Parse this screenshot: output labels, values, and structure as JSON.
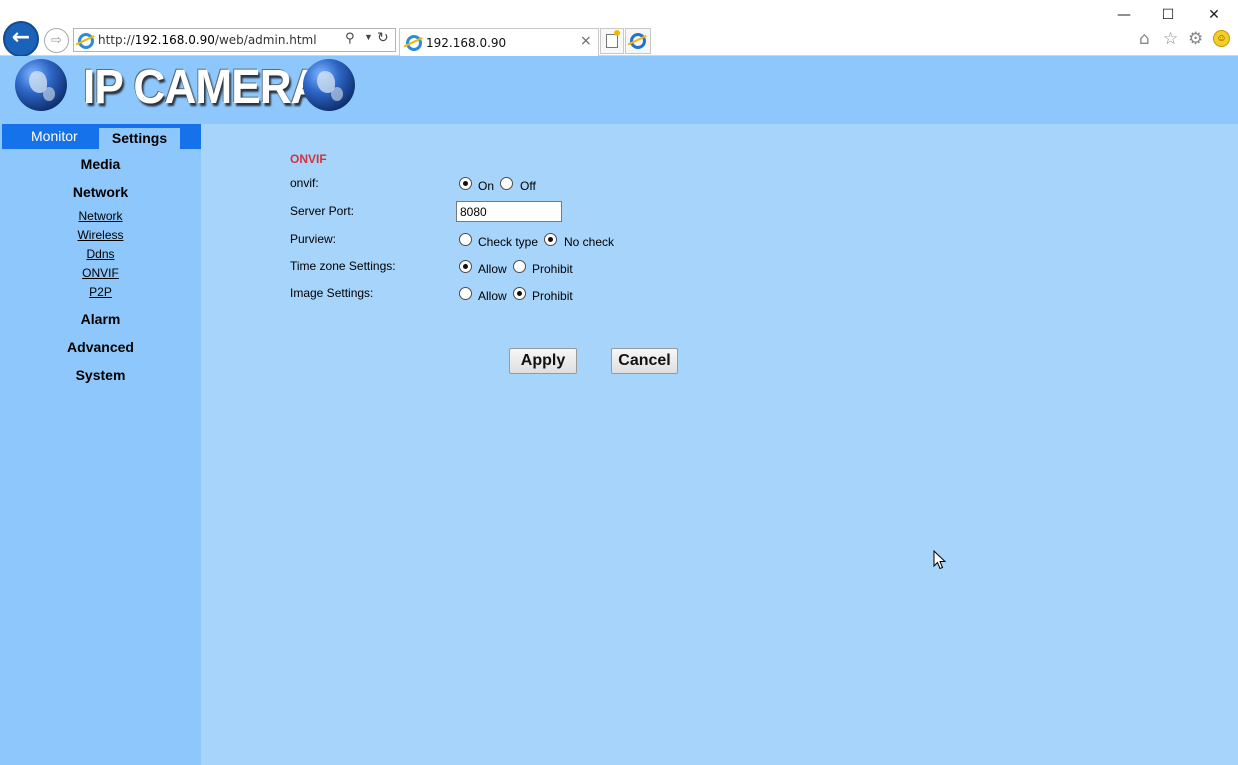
{
  "browser": {
    "window_controls": {
      "minimize": "—",
      "maximize": "☐",
      "close": "✕"
    },
    "address_prefix": "http://",
    "address_host": "192.168.0.90",
    "address_path": "/web/admin.html",
    "tab_title": "192.168.0.90",
    "tab_close": "×",
    "icons": [
      "back-arrow-icon",
      "forward-arrow-icon",
      "search-icon",
      "dropdown-icon",
      "refresh-icon",
      "home-icon",
      "favorites-star-icon",
      "settings-gear-icon",
      "feedback-smiley-icon"
    ]
  },
  "header": {
    "title": "IP CAMERA",
    "colors": {
      "banner": "#8ec7fb",
      "page": "#a6d4fb",
      "tab_bar": "#1672ea"
    }
  },
  "nav": {
    "tabs": [
      {
        "label": "Monitor",
        "active": false
      },
      {
        "label": "Settings",
        "active": true
      }
    ],
    "sections": [
      {
        "label": "Media"
      },
      {
        "label": "Network",
        "items": [
          "Network",
          "Wireless",
          "Ddns",
          "ONVIF",
          "P2P"
        ]
      },
      {
        "label": "Alarm"
      },
      {
        "label": "Advanced"
      },
      {
        "label": "System"
      }
    ]
  },
  "form": {
    "section_title": "ONVIF",
    "section_color": "#d4323c",
    "onvif": {
      "label": "onvif:",
      "options": [
        "On",
        "Off"
      ],
      "selected": "On"
    },
    "server_port": {
      "label": "Server Port:",
      "value": "8080"
    },
    "purview": {
      "label": "Purview:",
      "options": [
        "Check type",
        "No check"
      ],
      "selected": "No check"
    },
    "time_zone": {
      "label": "Time zone Settings:",
      "options": [
        "Allow",
        "Prohibit"
      ],
      "selected": "Allow"
    },
    "image": {
      "label": "Image Settings:",
      "options": [
        "Allow",
        "Prohibit"
      ],
      "selected": "Prohibit"
    },
    "apply_label": "Apply",
    "cancel_label": "Cancel"
  }
}
